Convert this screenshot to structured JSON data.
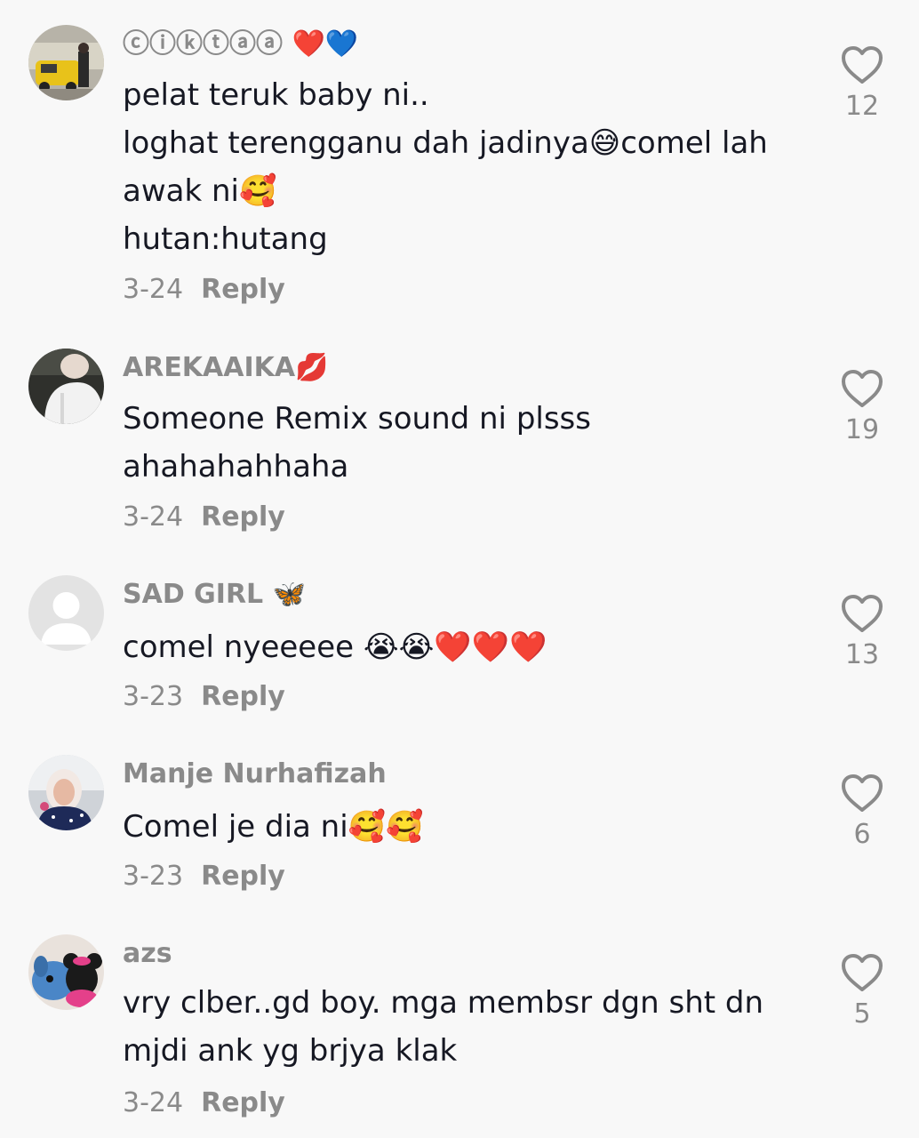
{
  "comments": [
    {
      "username": "ⓒⓘⓚⓣⓐⓐ ❤️💙",
      "lines": [
        "pelat teruk baby ni..",
        "loghat terengganu dah jadinya😅comel lah",
        "awak ni🥰",
        "hutan:hutang"
      ],
      "date": "3-24",
      "reply": "Reply",
      "likes": "12",
      "avatar": "avatar-photo-yellow-car"
    },
    {
      "username": "AREKAAIKA💋",
      "lines": [
        "Someone Remix sound ni plsss",
        "ahahahahhaha"
      ],
      "date": "3-24",
      "reply": "Reply",
      "likes": "19",
      "avatar": "avatar-photo-white-shirt"
    },
    {
      "username": "SAD GIRL 🦋",
      "lines": [
        "comel nyeeeee 😭😭❤️❤️❤️"
      ],
      "date": "3-23",
      "reply": "Reply",
      "likes": "13",
      "avatar": "default-avatar-icon"
    },
    {
      "username": "Manje Nurhafizah",
      "lines": [
        "Comel je dia ni🥰🥰"
      ],
      "date": "3-23",
      "reply": "Reply",
      "likes": "6",
      "avatar": "avatar-photo-hijab"
    },
    {
      "username": "azs",
      "lines": [
        "vry clber..gd boy. mga membsr dgn sht dn",
        "mjdi ank yg brjya klak"
      ],
      "date": "3-24",
      "reply": "Reply",
      "likes": "5",
      "avatar": "avatar-photo-plush-toys"
    }
  ],
  "colors": {
    "background": "#f8f8f8",
    "text": "#161823",
    "muted": "#8a8a8a"
  },
  "icons": {
    "like": "heart-outline-icon"
  }
}
